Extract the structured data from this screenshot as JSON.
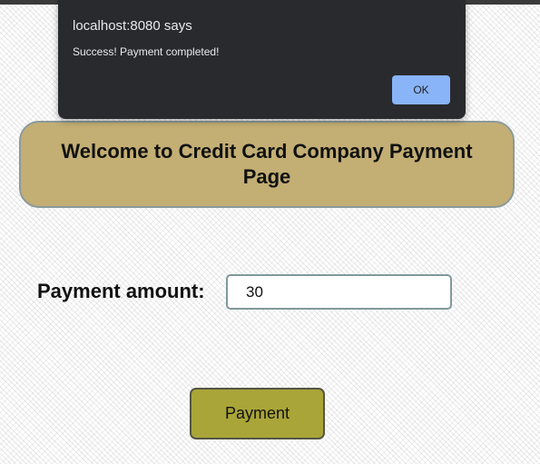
{
  "alert": {
    "origin": "localhost:8080 says",
    "message": "Success! Payment completed!",
    "ok_label": "OK"
  },
  "page": {
    "title": "Welcome to Credit Card Company Payment Page",
    "amount_label": "Payment amount:",
    "amount_value": "30",
    "pay_button_label": "Payment"
  },
  "colors": {
    "header_background": "#c3ae74",
    "pay_button_background": "#aaa538",
    "dialog_background": "#292a2d",
    "ok_button_background": "#8ab4f8"
  }
}
